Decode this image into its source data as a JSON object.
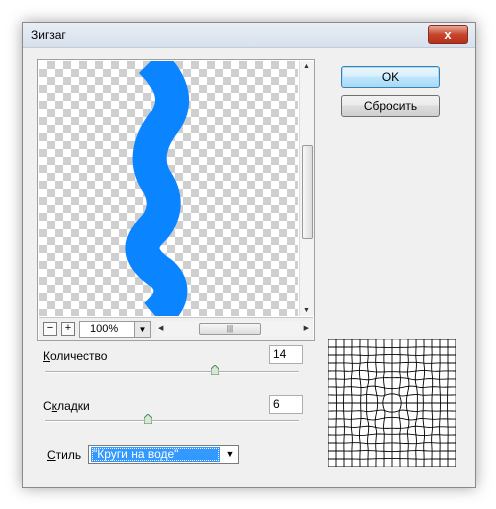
{
  "window": {
    "title": "Зигзаг",
    "close_symbol": "x"
  },
  "preview": {
    "zoom": "100%",
    "zoom_out": "−",
    "zoom_in": "+",
    "stripe_color": "#0a84ff"
  },
  "buttons": {
    "ok": "OK",
    "reset": "Сбросить"
  },
  "amount": {
    "label": "Количество",
    "value": "14"
  },
  "ridges": {
    "label": "Складки",
    "value": "6"
  },
  "style": {
    "label": "Стиль",
    "value": "\"Круги на воде\""
  }
}
